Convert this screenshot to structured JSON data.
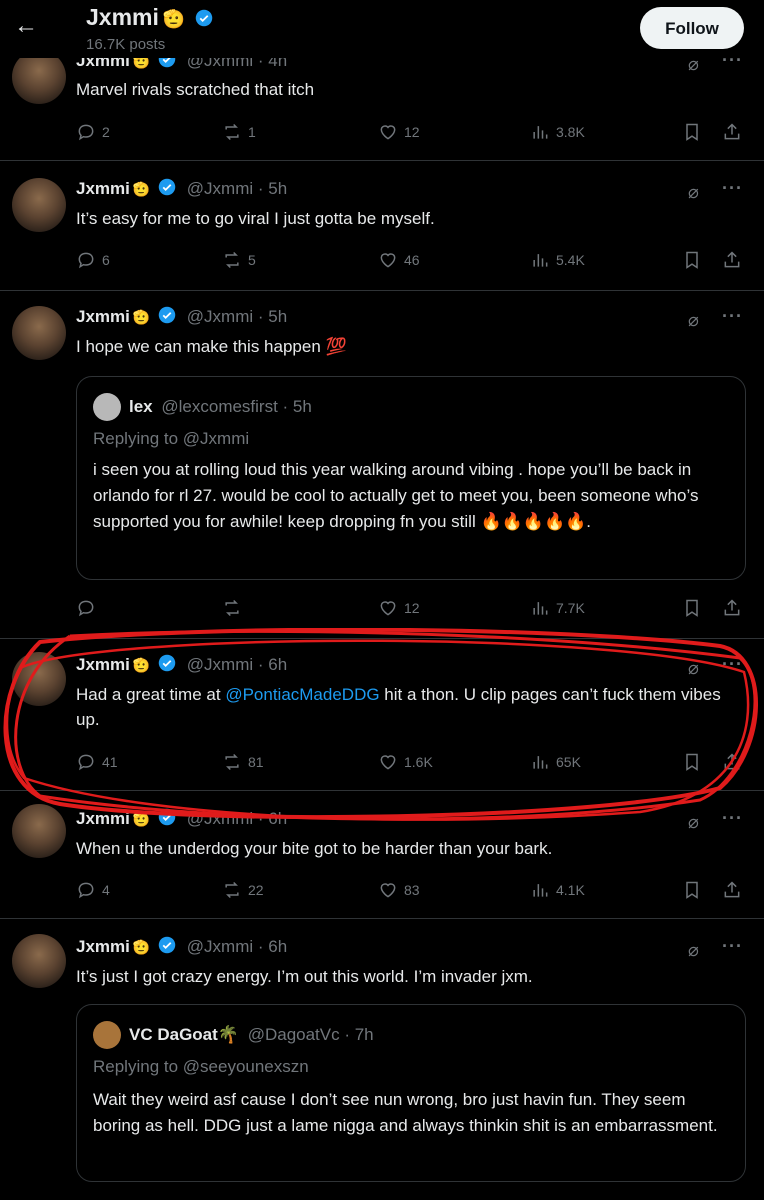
{
  "header": {
    "name": "Jxmmi",
    "name_emoji": "🫡",
    "posts": "16.7K posts",
    "follow_label": "Follow",
    "back_glyph": "←"
  },
  "tweets": [
    {
      "name": "Jxmmi",
      "emoji": "🫡",
      "handle": "@Jxmmi · 4h",
      "text": "Marvel rivals scratched that itch",
      "replies": "2",
      "reposts": "1",
      "likes": "12",
      "views": "3.8K"
    },
    {
      "name": "Jxmmi",
      "emoji": "🫡",
      "handle": "@Jxmmi · 5h",
      "text": "It’s easy for me to go viral I just gotta be myself.",
      "replies": "6",
      "reposts": "5",
      "likes": "46",
      "views": "5.4K"
    },
    {
      "name": "Jxmmi",
      "emoji": "🫡",
      "handle": "@Jxmmi · 5h",
      "text": "I hope we can make this happen 💯",
      "replies": "",
      "reposts": "",
      "likes": "12",
      "views": "7.7K",
      "quote": {
        "name": "lex",
        "handle": "@lexcomesfirst · 5h",
        "replying": "Replying to @Jxmmi",
        "text": "i seen you at rolling loud this year walking around vibing . hope you’ll be back in orlando for rl 27. would be cool to actually get to meet you, been someone who’s supported you for awhile! keep dropping fn you still 🔥🔥🔥🔥🔥."
      }
    },
    {
      "name": "Jxmmi",
      "emoji": "🫡",
      "handle": "@Jxmmi · 6h",
      "text_pre": "Had a great time at ",
      "mention": "@PontiacMadeDDG",
      "text_post": " hit a thon. U clip pages can’t fuck them vibes up.",
      "replies": "41",
      "reposts": "81",
      "likes": "1.6K",
      "views": "65K"
    },
    {
      "name": "Jxmmi",
      "emoji": "🫡",
      "handle": "@Jxmmi · 6h",
      "text": "When u the underdog your bite got to be harder than your bark.",
      "replies": "4",
      "reposts": "22",
      "likes": "83",
      "views": "4.1K"
    },
    {
      "name": "Jxmmi",
      "emoji": "🫡",
      "handle": "@Jxmmi · 6h",
      "text": "It’s just I got crazy energy. I’m out this world. I’m invader jxm.",
      "quote": {
        "name": "VC DaGoat",
        "name_emoji": "🌴",
        "handle": "@DagoatVc · 7h",
        "replying": "Replying to @seeyounexszn",
        "text": "Wait they weird asf cause I don’t see nun wrong, bro just havin fun. They seem boring as hell. DDG just a lame nigga and always thinkin shit is an embarrassment."
      }
    }
  ],
  "colors": {
    "background": "#000000",
    "text": "#e7e9ea",
    "muted": "#71767b",
    "accent": "#1d9bf0",
    "annotation": "#e01b1b"
  }
}
